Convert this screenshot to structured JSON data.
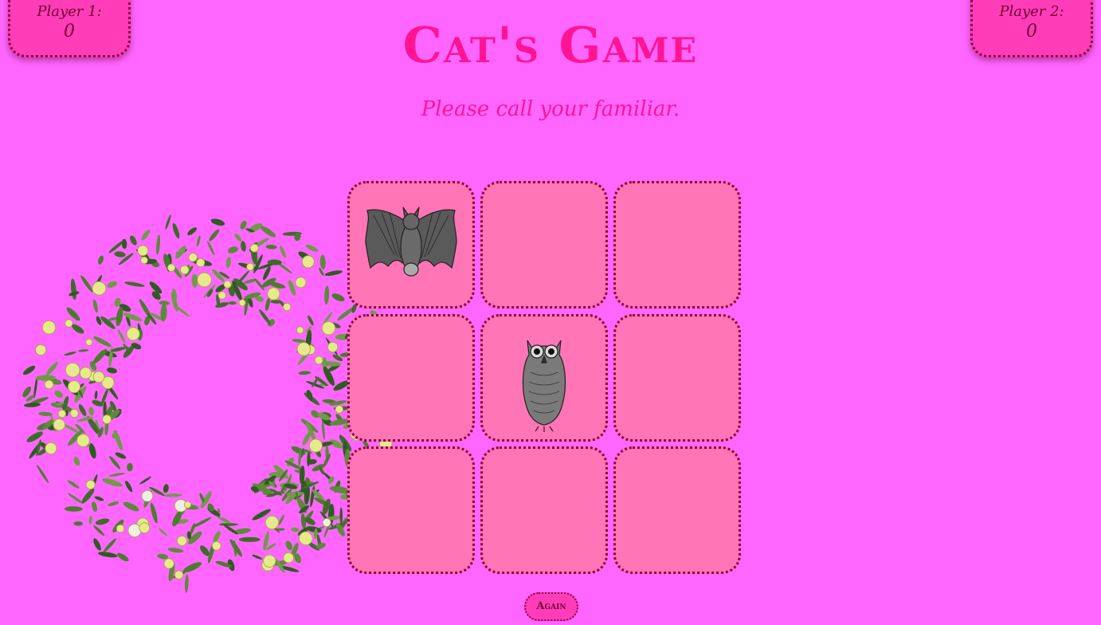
{
  "header": {
    "title": "Cat's Game",
    "subtitle": "Please call your familiar."
  },
  "scores": {
    "player1": {
      "label": "Player 1:",
      "value": "0"
    },
    "player2": {
      "label": "Player 2:",
      "value": "0"
    }
  },
  "board": {
    "cells": [
      {
        "mark": "bat"
      },
      {
        "mark": ""
      },
      {
        "mark": ""
      },
      {
        "mark": ""
      },
      {
        "mark": "owl"
      },
      {
        "mark": ""
      },
      {
        "mark": ""
      },
      {
        "mark": ""
      },
      {
        "mark": ""
      }
    ]
  },
  "controls": {
    "again_label": "Again"
  },
  "colors": {
    "background": "#ff66ff",
    "accent": "#ff1493",
    "cell": "#ff75b5",
    "panel": "#ff3db8",
    "border": "#8a0045"
  }
}
